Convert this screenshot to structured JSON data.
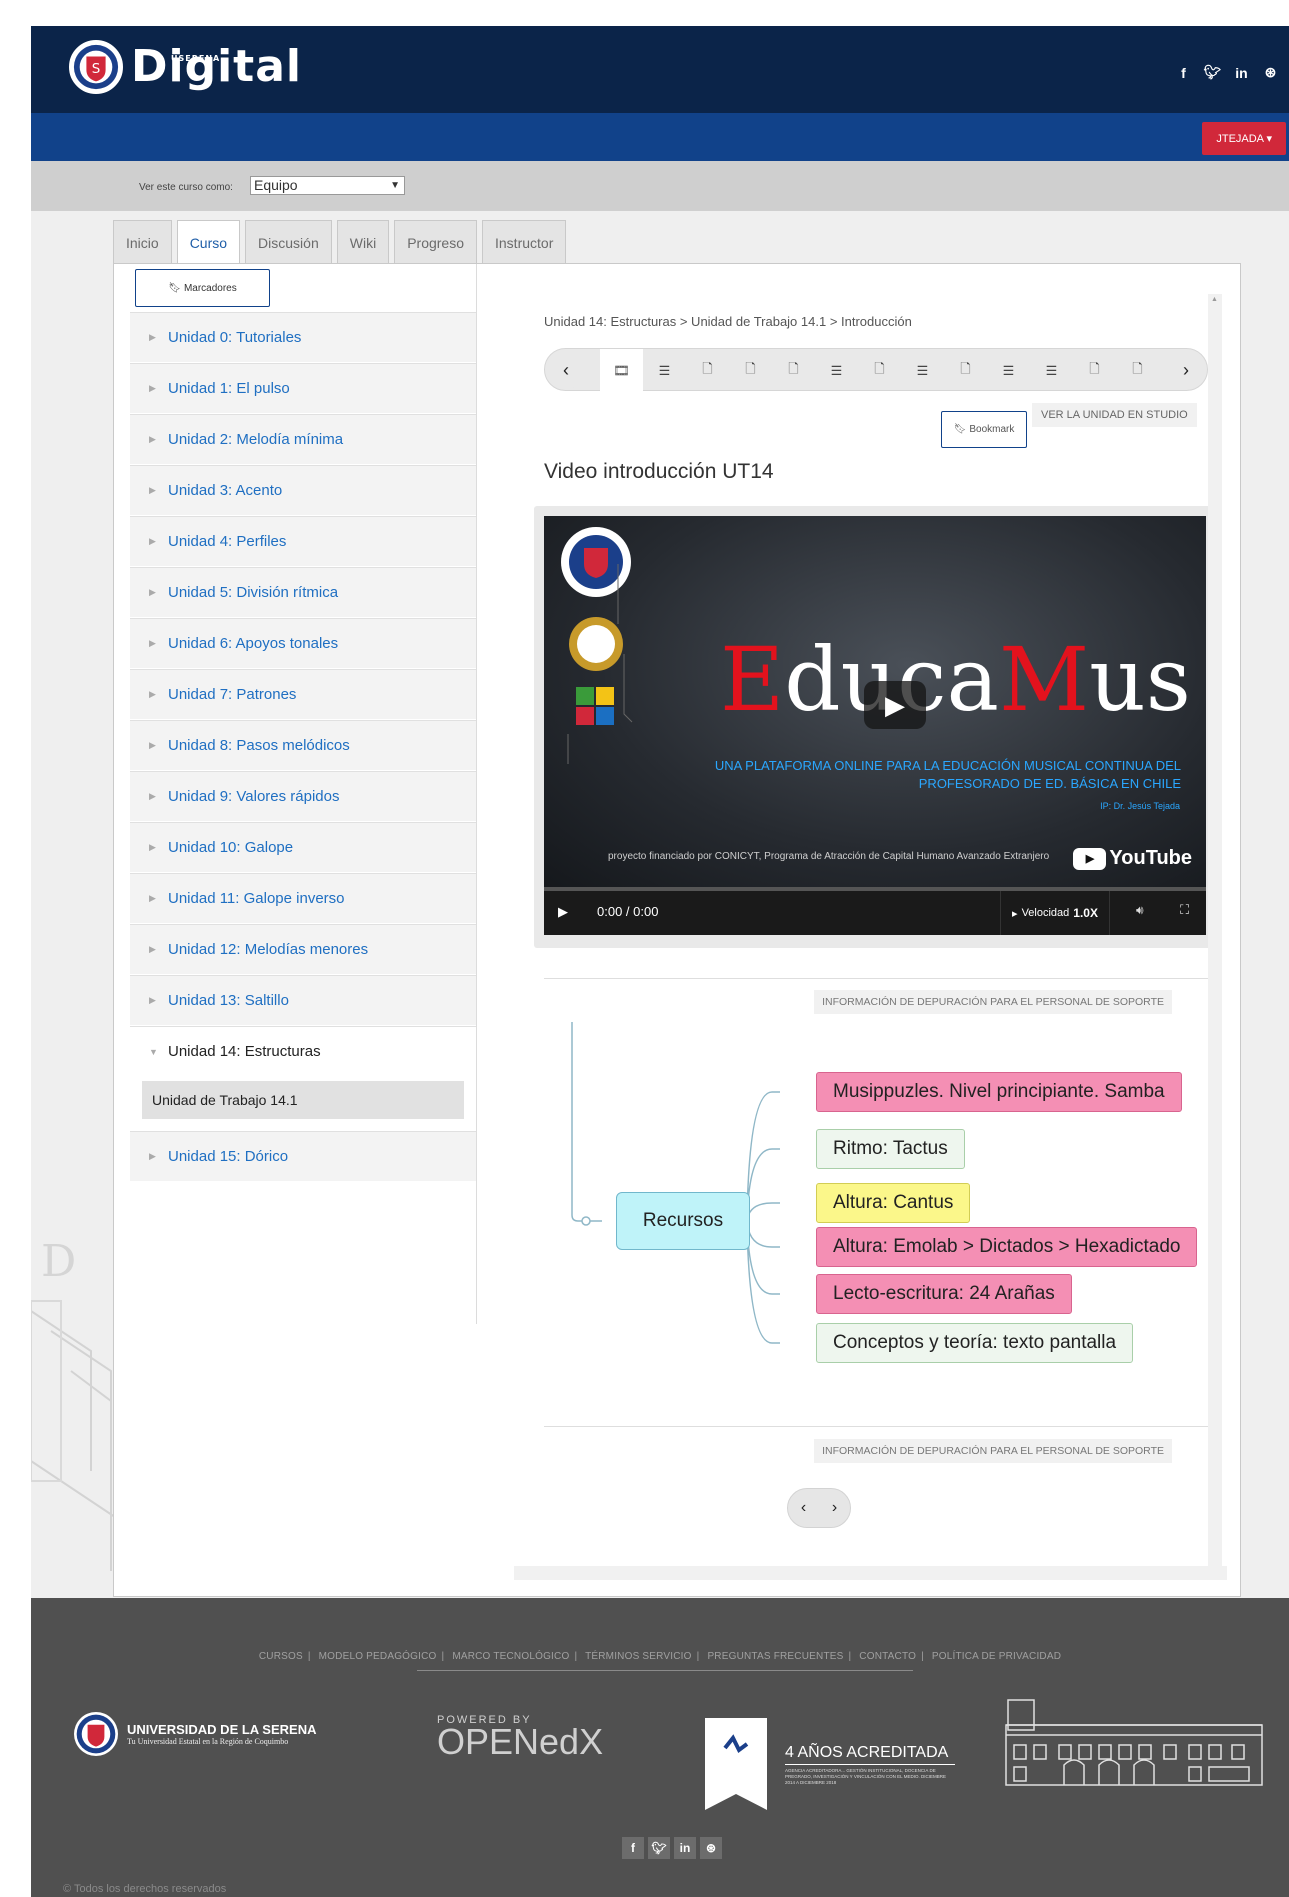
{
  "header": {
    "brand_small": "USERENA",
    "brand": "Digital",
    "social": [
      "f",
      "t",
      "in",
      "dr"
    ],
    "user_button": "JTEJADA ▾"
  },
  "viewas": {
    "label": "Ver este curso como:",
    "value": "Equipo"
  },
  "tabs": [
    "Inicio",
    "Curso",
    "Discusión",
    "Wiki",
    "Progreso",
    "Instructor"
  ],
  "sidebar": {
    "bookmarks_label": "Marcadores",
    "units": [
      "Unidad 0: Tutoriales",
      "Unidad 1: El pulso",
      "Unidad 2: Melodía mínima",
      "Unidad 3: Acento",
      "Unidad 4: Perfiles",
      "Unidad 5: División rítmica",
      "Unidad 6: Apoyos tonales",
      "Unidad 7: Patrones",
      "Unidad 8: Pasos melódicos",
      "Unidad 9: Valores rápidos",
      "Unidad 10: Galope",
      "Unidad 11: Galope inverso",
      "Unidad 12: Melodías menores",
      "Unidad 13: Saltillo",
      "Unidad 14: Estructuras",
      "Unidad 15: Dórico"
    ],
    "open_subunit": "Unidad de Trabajo 14.1"
  },
  "content": {
    "breadcrumb": "Unidad 14: Estructuras > Unidad de Trabajo 14.1 > Introducción",
    "bookmark_label": "Bookmark",
    "studio_label": "VER LA UNIDAD EN STUDIO",
    "heading": "Video introducción UT14",
    "video": {
      "title_parts": [
        "E",
        "duca",
        "M",
        "us"
      ],
      "subtitle": "UNA PLATAFORMA ONLINE PARA LA EDUCACIÓN MUSICAL CONTINUA DEL PROFESORADO DE ED. BÁSICA EN CHILE",
      "ip": "IP: Dr. Jesús Tejada",
      "project": "proyecto financiado por CONICYT, Programa de Atracción de Capital Humano Avanzado Extranjero",
      "yt_label": "YouTube",
      "time": "0:00 / 0:00",
      "speed_label": "Velocidad",
      "speed_value": "1.0X"
    },
    "debug_label": "INFORMACIÓN DE DEPURACIÓN PARA EL PERSONAL DE SOPORTE",
    "mindmap": {
      "root": "Recursos",
      "children": [
        "Musippuzles. Nivel principiante. Samba",
        "Ritmo: Tactus",
        "Altura: Cantus",
        "Altura: Emolab > Dictados > Hexadictado",
        "Lecto-escritura:  24 Arañas",
        "Conceptos y teoría: texto pantalla"
      ]
    }
  },
  "footer": {
    "links": [
      "CURSOS",
      "MODELO PEDAGÓGICO",
      "MARCO TECNOLÓGICO",
      "TÉRMINOS SERVICIO",
      "PREGUNTAS FRECUENTES",
      "CONTACTO",
      "POLÍTICA DE PRIVACIDAD"
    ],
    "uls_name": "UNIVERSIDAD DE LA SERENA",
    "uls_tag": "Tu Universidad Estatal en la Región de Coquimbo",
    "powered": "POWERED BY",
    "openedx": "OPENedX",
    "accred": "4 AÑOS ACREDITADA",
    "accred_detail": "AGENCIA ACREDITADORA... GESTIÓN INSTITUCIONAL, DOCENCIA DE PREGRADO, INVESTIGACIÓN Y VINCULACIÓN CON EL MEDIO. DICIEMBRE 2014 A DICIEMBRE 2018",
    "copyright": "© Todos los derechos reservados"
  },
  "colors": {
    "navy": "#0b2449",
    "blue": "#11428a",
    "red": "#d1283a",
    "link": "#1f6fc2"
  }
}
